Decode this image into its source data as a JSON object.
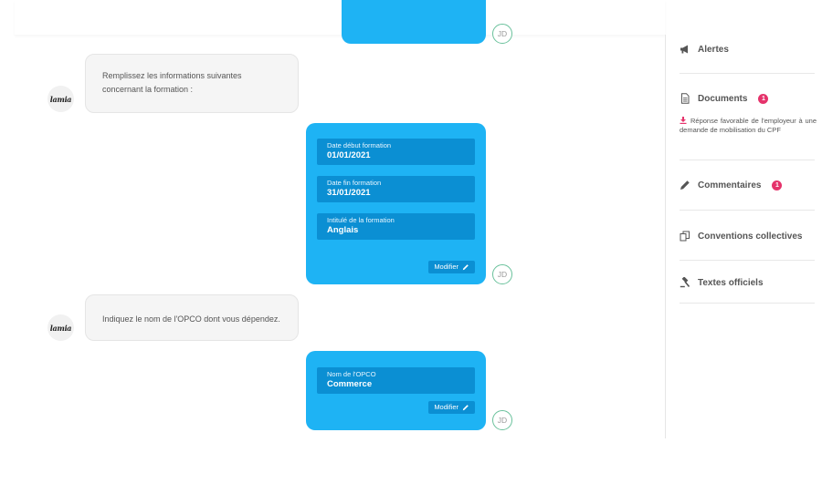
{
  "colors": {
    "card_bg": "#1eb3f4",
    "field_bg": "#0b8fd3",
    "badge": "#e5336b",
    "avatar_border": "#69c19b"
  },
  "chat": {
    "user_initials": "JD",
    "bot_logo_text": "lamia",
    "messages": [
      {
        "text": "Remplissez les informations suivantes concernant la formation :"
      },
      {
        "text": "Indiquez le nom de l'OPCO dont vous dépendez."
      }
    ],
    "form1": {
      "fields": [
        {
          "label": "Date début formation",
          "value": "01/01/2021"
        },
        {
          "label": "Date fin formation",
          "value": "31/01/2021"
        },
        {
          "label": "Intitulé de la formation",
          "value": "Anglais"
        }
      ],
      "edit_label": "Modifier"
    },
    "form2": {
      "fields": [
        {
          "label": "Nom de l'OPCO",
          "value": "Commerce"
        }
      ],
      "edit_label": "Modifier"
    }
  },
  "sidebar": {
    "alertes": {
      "label": "Alertes",
      "icon": "megaphone-icon"
    },
    "documents": {
      "label": "Documents",
      "icon": "document-icon",
      "count": "1",
      "link_text": "Réponse favorable de l'employeur à une demande de mobilisation du CPF",
      "link_icon": "download-icon"
    },
    "commentaires": {
      "label": "Commentaires",
      "icon": "pencil-icon",
      "count": "1"
    },
    "conventions": {
      "label": "Conventions collectives",
      "icon": "copy-icon"
    },
    "textes": {
      "label": "Textes officiels",
      "icon": "gavel-icon"
    }
  }
}
